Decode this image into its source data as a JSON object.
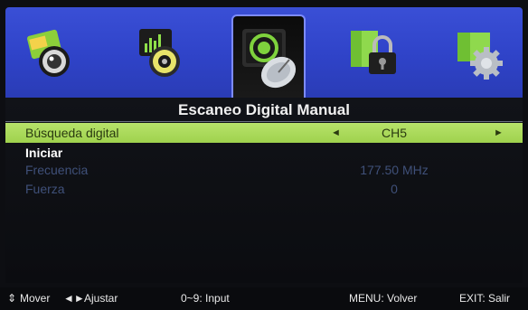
{
  "menu": {
    "title": "Escaneo Digital Manual",
    "rows": [
      {
        "label": "Búsqueda digital",
        "value": "CH5",
        "left_arrow": "◄",
        "right_arrow": "►"
      },
      {
        "label": "Iniciar"
      },
      {
        "label": "Frecuencia",
        "value": "177.50 MHz"
      },
      {
        "label": "Fuerza",
        "value": "0"
      }
    ]
  },
  "tabs": [
    {
      "icon": "picture-icon"
    },
    {
      "icon": "sound-icon"
    },
    {
      "icon": "channel-satellite-icon",
      "selected": true
    },
    {
      "icon": "lock-icon"
    },
    {
      "icon": "setup-gear-icon"
    }
  ],
  "help": {
    "move": "Mover",
    "move_icon": "⇕",
    "adjust_icon": "◄►",
    "adjust": "Ajustar",
    "input": "0~9: Input",
    "menu": "MENU: Volver",
    "exit": "EXIT: Salir"
  },
  "colors": {
    "icon_bar": "#3a4fd6",
    "highlight": "#a8d958",
    "dim_text": "#3f5079"
  }
}
